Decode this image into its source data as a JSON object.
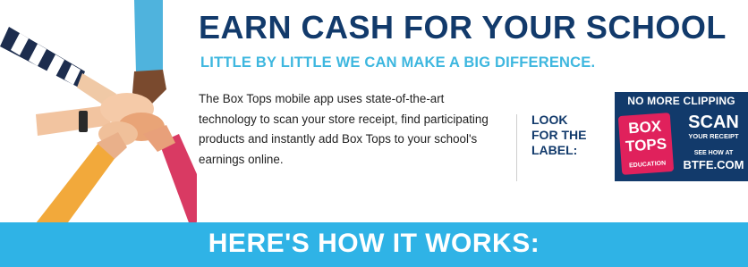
{
  "header": {
    "title": "EARN CASH FOR YOUR SCHOOL",
    "subtitle": "LITTLE BY LITTLE WE CAN MAKE A BIG DIFFERENCE."
  },
  "body": {
    "paragraph": "The Box Tops mobile app uses state-of-the-art technology to scan your store receipt, find participating products and instantly add Box Tops to your school's earnings online."
  },
  "label_callout": {
    "text": "LOOK\nFOR THE\nLABEL:"
  },
  "badge": {
    "top_text": "NO MORE CLIPPING",
    "logo_line1": "BOX",
    "logo_line2": "TOPS",
    "logo_line3": "EDUCATION",
    "scan": "SCAN",
    "scan_sub": "YOUR RECEIPT",
    "see_how": "SEE HOW AT",
    "url": "BTFE.COM"
  },
  "banner": {
    "text": "HERE'S HOW IT WORKS:"
  },
  "colors": {
    "navy": "#123a6b",
    "light_blue": "#3eb7df",
    "banner_blue": "#2fb3e6",
    "box_tops_pink": "#e0215c"
  }
}
